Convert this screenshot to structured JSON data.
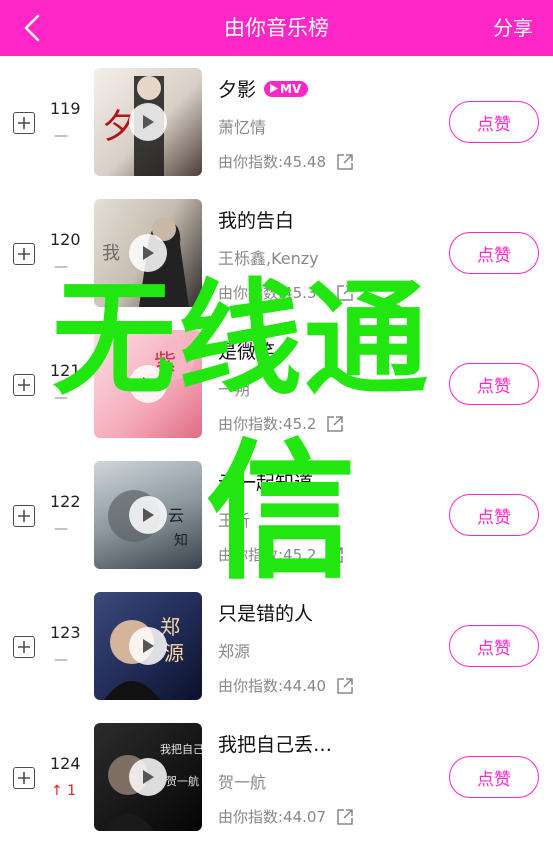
{
  "header": {
    "title": "由你音乐榜",
    "share_label": "分享",
    "back_icon": "chevron-left-icon",
    "bg_color": "#ff26c8"
  },
  "songs": [
    {
      "rank": "119",
      "trend": "—",
      "title": "夕影",
      "mv": "MV",
      "artist": "萧忆情",
      "index": "由你指数:45.48",
      "like": "点赞",
      "cover_colors": [
        "#f1ece7",
        "#5a4d46"
      ]
    },
    {
      "rank": "120",
      "trend": "—",
      "title": "我的告白",
      "mv": "",
      "artist": "王栎鑫,Kenzy",
      "index": "由你指数:45.37",
      "like": "点赞",
      "cover_colors": [
        "#d9d4cb",
        "#3c3a39"
      ]
    },
    {
      "rank": "121",
      "trend": "—",
      "title": "是微笑",
      "mv": "",
      "artist": "一朔",
      "index": "由你指数:45.2",
      "like": "点赞",
      "cover_colors": [
        "#f9c7d0",
        "#d45a72"
      ]
    },
    {
      "rank": "122",
      "trend": "—",
      "title": "云一起知道",
      "mv": "",
      "artist": "王析",
      "index": "由你指数:45.2",
      "like": "点赞",
      "cover_colors": [
        "#b9c4cb",
        "#3d4650"
      ]
    },
    {
      "rank": "123",
      "trend": "—",
      "title": "只是错的人",
      "mv": "",
      "artist": "郑源",
      "index": "由你指数:44.40",
      "like": "点赞",
      "cover_colors": [
        "#2d3b6a",
        "#0f1531"
      ]
    },
    {
      "rank": "124",
      "trend": "↑ 1",
      "title": "我把自己丢…",
      "mv": "",
      "artist": "贺一航",
      "index": "由你指数:44.07",
      "like": "点赞",
      "cover_colors": [
        "#2a2a2a",
        "#0b0b0b"
      ]
    }
  ],
  "watermark": {
    "line1": "无线通",
    "line2": "信",
    "color": "#22e60f"
  }
}
